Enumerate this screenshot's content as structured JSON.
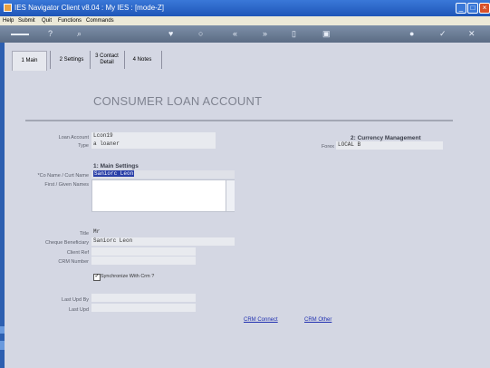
{
  "window": {
    "title": "IES Navigator Client v8.04 : My IES :      [mode-Z]"
  },
  "menu": [
    "Help",
    "Submit",
    "Quit",
    "Functions",
    "Commands"
  ],
  "toolbar": {
    "help": "?",
    "search": "⌕",
    "nav_prev_prev": "«",
    "nav_next_next": "»"
  },
  "tabs": [
    {
      "label": "1 Main"
    },
    {
      "label": "2 Settings"
    },
    {
      "label": "3 Contact Detail"
    },
    {
      "label": "4 Notes"
    }
  ],
  "form": {
    "title": "CONSUMER LOAN ACCOUNT"
  },
  "fields": {
    "loan_account": {
      "label": "Loan Account",
      "value": "Lcon19"
    },
    "type": {
      "label": "Type",
      "value": "a loaner"
    },
    "forex": {
      "label": "Forex",
      "value": "LOCAL B"
    },
    "co_name": {
      "label": "*Co Name / Curt Name",
      "value": "Saniorc Leon"
    },
    "first_names": {
      "label": "First / Given Names",
      "value": ""
    },
    "title": {
      "label": "Title",
      "value": "Mr"
    },
    "cheque_beneficiary": {
      "label": "Cheque Beneficiary",
      "value": "Saniorc Leon"
    },
    "client_ref": {
      "label": "Client Ref",
      "value": ""
    },
    "crm_number": {
      "label": "CRM Number",
      "value": ""
    },
    "last_upd_by": {
      "label": "Last Upd By",
      "value": ""
    },
    "last_upd": {
      "label": "Last Upd",
      "value": ""
    }
  },
  "sections": {
    "main_settings": "1: Main Settings",
    "currency_management": "2: Currency Management"
  },
  "sync": {
    "label": "Synchronize With Crm ?",
    "checked": true
  },
  "links": {
    "crm_connect": "CRM Connect",
    "crm_other": "CRM Other"
  }
}
